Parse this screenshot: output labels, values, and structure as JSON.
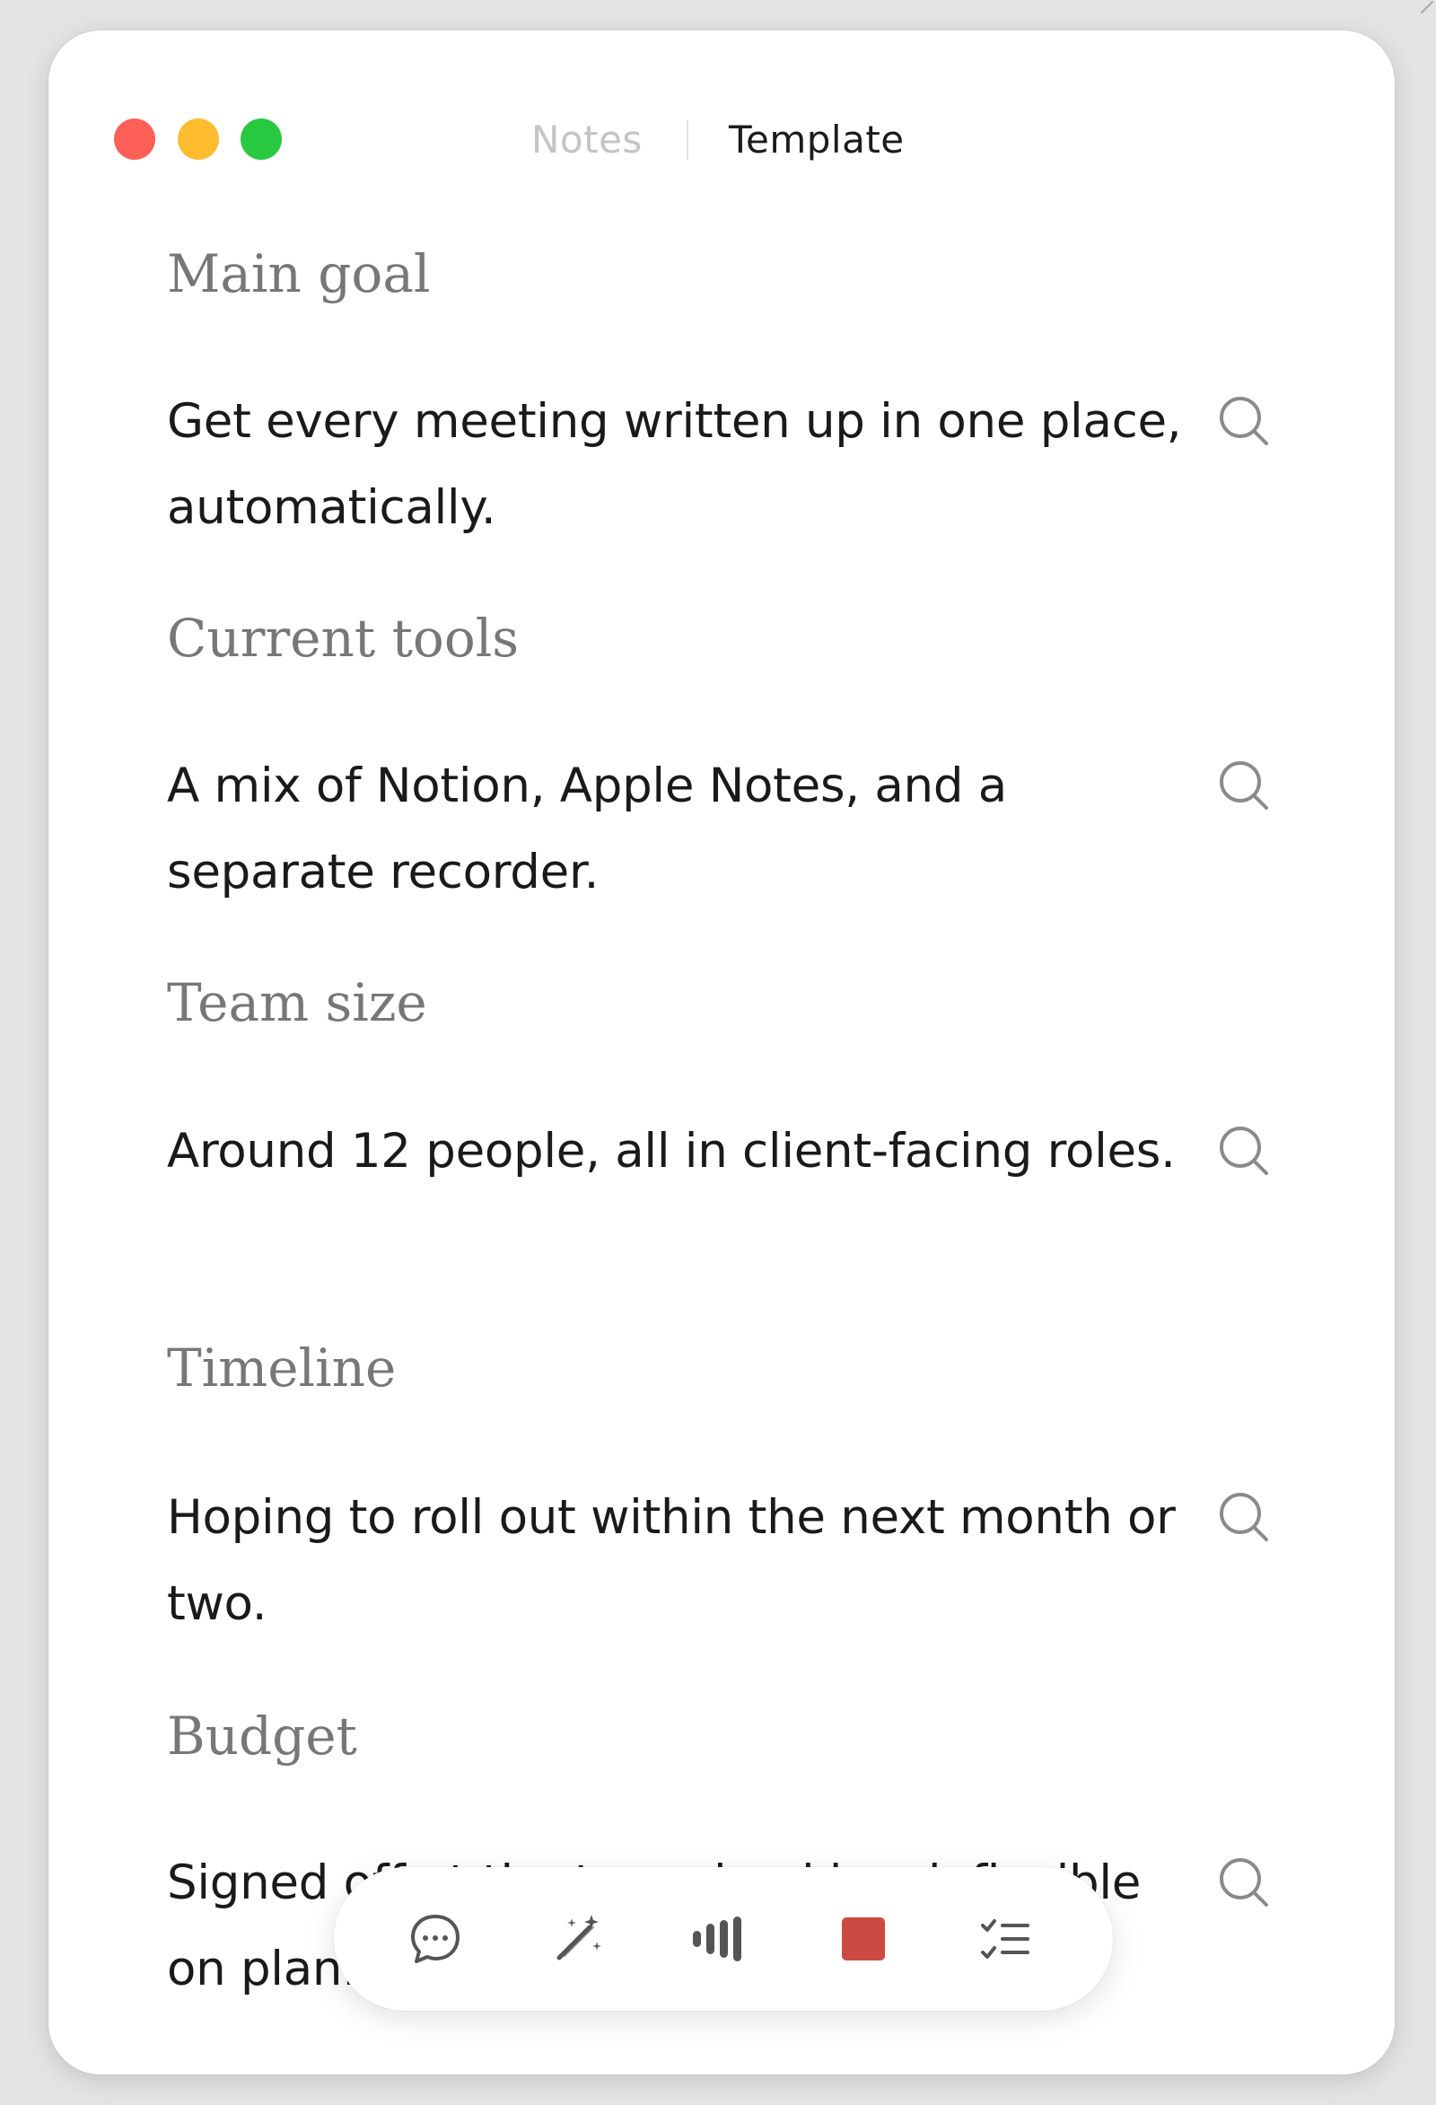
{
  "window": {
    "tabs": [
      {
        "label": "Notes",
        "active": false
      },
      {
        "label": "Template",
        "active": true
      }
    ]
  },
  "sections": [
    {
      "heading": "Main goal",
      "body": "Get every meeting written up in one place, automatically."
    },
    {
      "heading": "Current tools",
      "body": "A mix of Notion, Apple Notes, and a separate recorder."
    },
    {
      "heading": "Team size",
      "body": "Around 12 people, all in client-facing roles."
    },
    {
      "heading": "Timeline",
      "body": "Hoping to roll out within the next month or two."
    },
    {
      "heading": "Budget",
      "body": "Signed off at the team-lead level, flexible on plan."
    }
  ],
  "toolbar": {
    "items": [
      {
        "icon": "chat-bubble-icon"
      },
      {
        "icon": "magic-wand-icon"
      },
      {
        "icon": "audio-waveform-icon"
      },
      {
        "icon": "stop-recording-icon"
      },
      {
        "icon": "checklist-icon"
      }
    ]
  },
  "colors": {
    "close": "#fe5f57",
    "minimize": "#febc2e",
    "zoom": "#28c840",
    "stop": "#cc4a42"
  }
}
